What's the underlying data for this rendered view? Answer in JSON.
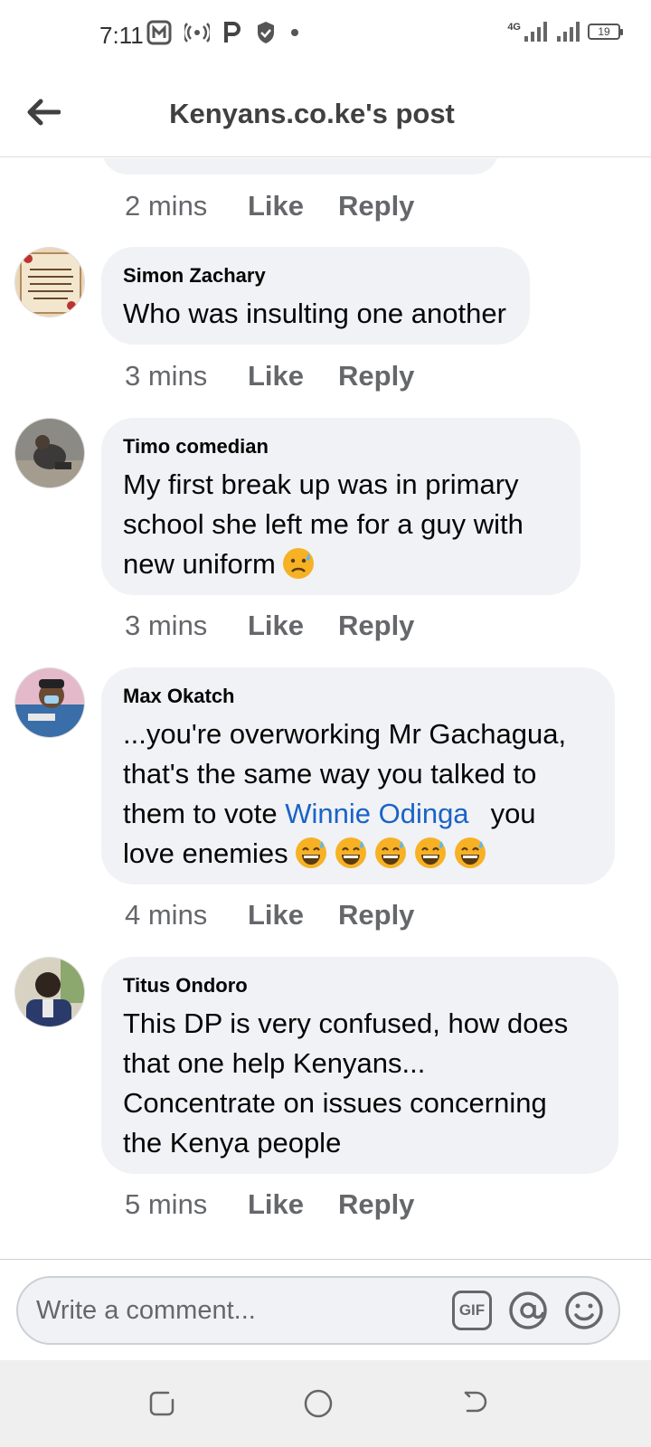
{
  "status_bar": {
    "time": "7:11",
    "network": "4G",
    "battery": "19"
  },
  "header": {
    "title": "Kenyans.co.ke's post",
    "back_icon": "arrow-left-icon"
  },
  "top_actions": {
    "time": "2 mins",
    "like": "Like",
    "reply": "Reply"
  },
  "comments": [
    {
      "author": "Simon Zachary",
      "text": "Who was insulting one another",
      "time": "3 mins",
      "like": "Like",
      "reply": "Reply"
    },
    {
      "author": "Timo comedian",
      "text_line1": "My first break up was in primary",
      "text_line2": "school she left me for a guy with",
      "text_line3": "new uniform",
      "emoji": "sad-sweat-face-emoji",
      "time": "3 mins",
      "like": "Like",
      "reply": "Reply"
    },
    {
      "author": "Max Okatch",
      "text_line1": "...you're overworking Mr Gachagua,",
      "text_line2": "that's the same way you talked to",
      "text_line3_before": "them to vote ",
      "mention": "Winnie Odinga",
      "text_line3_after": "you",
      "text_line4": "love enemies",
      "emoji": "grinning-sweat-face-emoji",
      "time": "4 mins",
      "like": "Like",
      "reply": "Reply"
    },
    {
      "author": "Titus Ondoro",
      "text_line1": "This DP is very confused, how does",
      "text_line2": "that one help Kenyans...",
      "text_line3": "Concentrate on issues concerning",
      "text_line4": "the Kenya people",
      "time": "5 mins",
      "like": "Like",
      "reply": "Reply"
    }
  ],
  "composer": {
    "placeholder": "Write a comment...",
    "gif_label": "GIF"
  },
  "colors": {
    "bubble": "#f0f2f5",
    "mention": "#1a63c6",
    "secondary_text": "#65676b"
  }
}
